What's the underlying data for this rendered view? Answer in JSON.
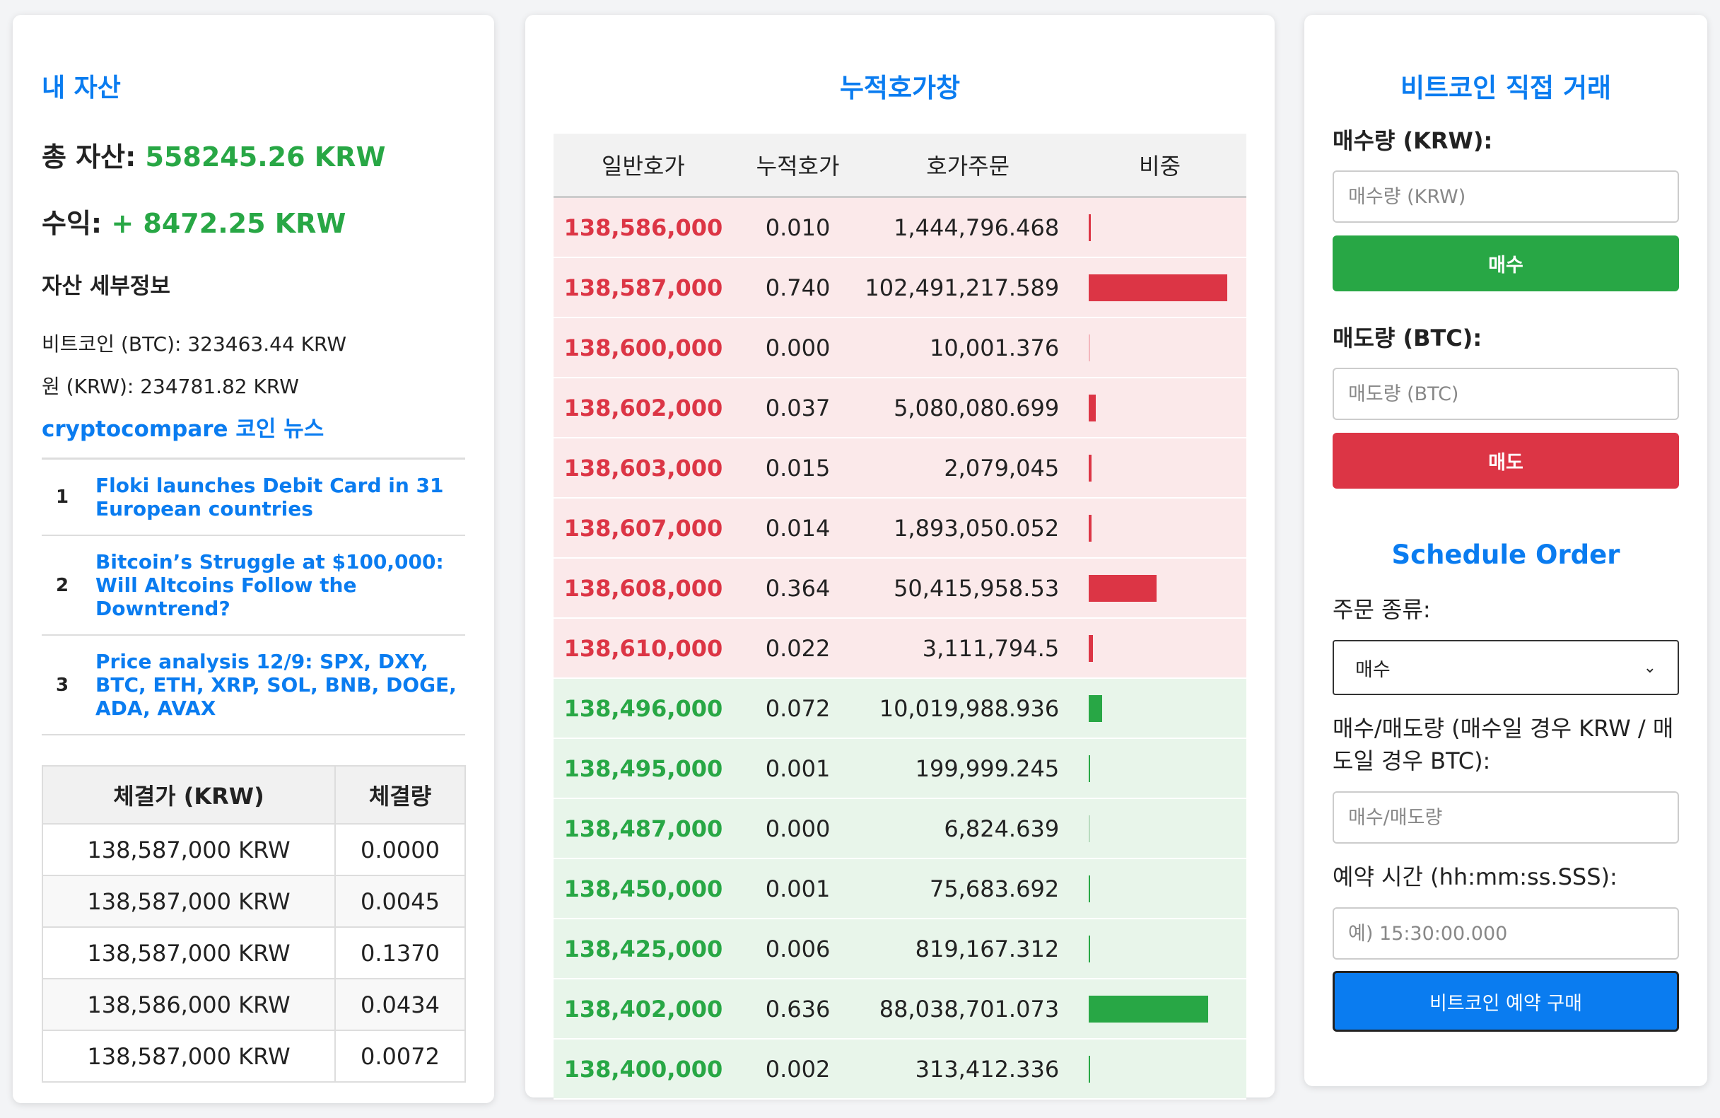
{
  "assets": {
    "title": "내 자산",
    "total_label": "총 자산: ",
    "total_value": "558245.26 KRW",
    "profit_label": "수익: ",
    "profit_value": "+ 8472.25 KRW",
    "detail_title": "자산 세부정보",
    "btc_line": "비트코인 (BTC): 323463.44 KRW",
    "krw_line": "원 (KRW): 234781.82 KRW"
  },
  "news": {
    "title": "cryptocompare 코인 뉴스",
    "items": [
      {
        "num": "1",
        "headline": "Floki launches Debit Card in 31 European countries"
      },
      {
        "num": "2",
        "headline": "Bitcoin’s Struggle at $100,000: Will Altcoins Follow the Downtrend?"
      },
      {
        "num": "3",
        "headline": "Price analysis 12/9: SPX, DXY, BTC, ETH, XRP, SOL, BNB, DOGE, ADA, AVAX"
      }
    ]
  },
  "trades": {
    "headers": [
      "체결가 (KRW)",
      "체결량"
    ],
    "rows": [
      [
        "138,587,000 KRW",
        "0.0000"
      ],
      [
        "138,587,000 KRW",
        "0.0045"
      ],
      [
        "138,587,000 KRW",
        "0.1370"
      ],
      [
        "138,586,000 KRW",
        "0.0434"
      ],
      [
        "138,587,000 KRW",
        "0.0072"
      ]
    ]
  },
  "orderbook": {
    "title": "누적호가창",
    "headers": [
      "일반호가",
      "누적호가",
      "호가주문",
      "비중"
    ],
    "asks": [
      {
        "price": "138,586,000",
        "acc": "0.010",
        "order": "1,444,796.468",
        "weight": 0.013
      },
      {
        "price": "138,587,000",
        "acc": "0.740",
        "order": "102,491,217.589",
        "weight": 1.0
      },
      {
        "price": "138,600,000",
        "acc": "0.000",
        "order": "10,001.376",
        "weight": 0.0
      },
      {
        "price": "138,602,000",
        "acc": "0.037",
        "order": "5,080,080.699",
        "weight": 0.05
      },
      {
        "price": "138,603,000",
        "acc": "0.015",
        "order": "2,079,045",
        "weight": 0.02
      },
      {
        "price": "138,607,000",
        "acc": "0.014",
        "order": "1,893,050.052",
        "weight": 0.019
      },
      {
        "price": "138,608,000",
        "acc": "0.364",
        "order": "50,415,958.53",
        "weight": 0.49
      },
      {
        "price": "138,610,000",
        "acc": "0.022",
        "order": "3,111,794.5",
        "weight": 0.03
      }
    ],
    "bids": [
      {
        "price": "138,496,000",
        "acc": "0.072",
        "order": "10,019,988.936",
        "weight": 0.097
      },
      {
        "price": "138,495,000",
        "acc": "0.001",
        "order": "199,999.245",
        "weight": 0.005
      },
      {
        "price": "138,487,000",
        "acc": "0.000",
        "order": "6,824.639",
        "weight": 0.0
      },
      {
        "price": "138,450,000",
        "acc": "0.001",
        "order": "75,683.692",
        "weight": 0.005
      },
      {
        "price": "138,425,000",
        "acc": "0.006",
        "order": "819,167.312",
        "weight": 0.008
      },
      {
        "price": "138,402,000",
        "acc": "0.636",
        "order": "88,038,701.073",
        "weight": 0.86
      },
      {
        "price": "138,400,000",
        "acc": "0.002",
        "order": "313,412.336",
        "weight": 0.005
      }
    ]
  },
  "direct": {
    "title": "비트코인 직접 거래",
    "buy_label": "매수량 (KRW):",
    "buy_placeholder": "매수량 (KRW)",
    "buy_button": "매수",
    "sell_label": "매도량 (BTC):",
    "sell_placeholder": "매도량 (BTC)",
    "sell_button": "매도"
  },
  "schedule": {
    "title": "Schedule Order",
    "type_label": "주문 종류:",
    "type_selected": "매수",
    "amount_label": "매수/매도량 (매수일 경우 KRW / 매도일 경우 BTC):",
    "amount_placeholder": "매수/매도량",
    "time_label": "예약 시간 (hh:mm:ss.SSS):",
    "time_placeholder": "예) 15:30:00.000",
    "submit_button": "비트코인 예약 구매"
  },
  "colors": {
    "accent": "#0a7cf0",
    "buy": "#28a745",
    "sell": "#dc3545"
  }
}
